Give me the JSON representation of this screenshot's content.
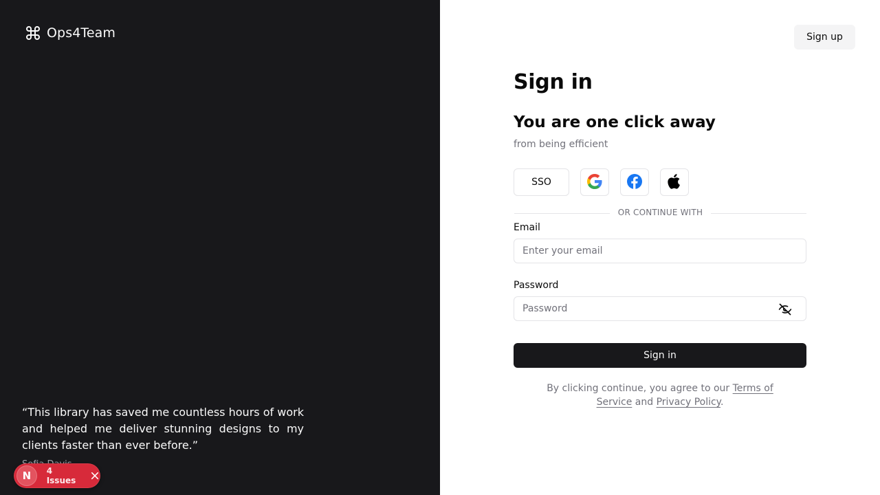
{
  "brand": {
    "name": "Ops4Team",
    "icon": "command-icon"
  },
  "testimonial": {
    "quote": "“This library has saved me countless hours of work and helped me deliver stunning designs to my clients faster than ever before.”",
    "author": "Sofia Davis"
  },
  "issues_badge": {
    "logo_letter": "N",
    "label": "4 Issues",
    "close_icon": "close-icon"
  },
  "header": {
    "signup_label": "Sign up"
  },
  "main": {
    "title": "Sign in",
    "headline": "You are one click away",
    "subline": "from being efficient",
    "sso_label": "SSO",
    "social_icons": [
      "google-icon",
      "facebook-icon",
      "apple-icon"
    ],
    "divider_text": "OR CONTINUE WITH",
    "email": {
      "label": "Email",
      "placeholder": "Enter your email",
      "value": ""
    },
    "password": {
      "label": "Password",
      "placeholder": "Password",
      "value": "",
      "toggle_icon": "eye-off-icon"
    },
    "submit_label": "Sign in",
    "legal": {
      "prefix": "By clicking continue, you agree to our ",
      "terms": "Terms of Service",
      "conjunction": " and ",
      "privacy": "Privacy Policy",
      "suffix": "."
    }
  },
  "colors": {
    "left_panel_bg": "#18181b",
    "primary_button_bg": "#18181b",
    "issues_badge_bg": "#d72a3a",
    "muted_text": "#71717a",
    "border": "#e4e4e7"
  }
}
